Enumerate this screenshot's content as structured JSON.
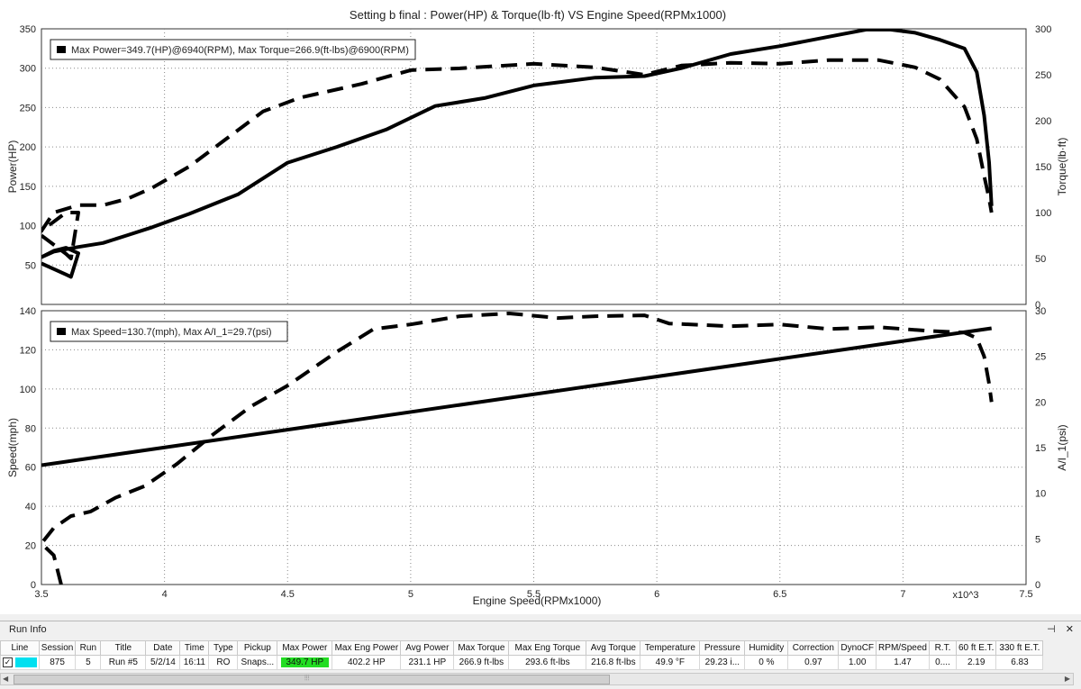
{
  "chart_data": [
    {
      "type": "line",
      "title": "Setting b final : Power(HP) & Torque(lb·ft) VS Engine Speed(RPMx1000)",
      "xlabel": "Engine Speed(RPMx1000)",
      "x_multiplier_label": "x10^3",
      "xlim": [
        3.5,
        7.5
      ],
      "x_ticks": [
        3.5,
        4,
        4.5,
        5,
        5.5,
        6,
        6.5,
        7,
        7.5
      ],
      "ylabel": "Power(HP)",
      "ylim": [
        0,
        350
      ],
      "y_ticks": [
        50,
        100,
        150,
        200,
        250,
        300,
        350
      ],
      "y2label": "Torque(lb·ft)",
      "y2lim": [
        0,
        300
      ],
      "y2_ticks": [
        0,
        50,
        100,
        150,
        200,
        250,
        300
      ],
      "grid": true,
      "legend_text": "Max Power=349.7(HP)@6940(RPM), Max Torque=266.9(ft-lbs)@6900(RPM)",
      "legend_position": "top-left",
      "series": [
        {
          "axis": "left",
          "style": "solid",
          "x": [
            3.5,
            3.55,
            3.6,
            3.62,
            3.65,
            3.6,
            3.55,
            3.5,
            3.55,
            3.65,
            3.75,
            3.85,
            3.95,
            4.1,
            4.3,
            4.5,
            4.7,
            4.9,
            5.1,
            5.3,
            5.5,
            5.75,
            5.95,
            6.1,
            6.3,
            6.5,
            6.7,
            6.85,
            6.95,
            7.05,
            7.15,
            7.25,
            7.3,
            7.33,
            7.35,
            7.36
          ],
          "values": [
            52,
            45,
            38,
            35,
            65,
            72,
            68,
            60,
            67,
            73,
            78,
            88,
            98,
            115,
            140,
            180,
            200,
            222,
            252,
            262,
            278,
            288,
            290,
            300,
            318,
            328,
            340,
            349,
            349,
            345,
            336,
            325,
            295,
            240,
            180,
            125
          ]
        },
        {
          "axis": "right",
          "style": "dashed",
          "x": [
            3.5,
            3.6,
            3.62,
            3.65,
            3.6,
            3.5,
            3.55,
            3.65,
            3.75,
            3.85,
            3.95,
            4.1,
            4.25,
            4.4,
            4.55,
            4.8,
            5.0,
            5.2,
            5.5,
            5.75,
            5.95,
            6.1,
            6.3,
            6.5,
            6.7,
            6.9,
            7.05,
            7.15,
            7.25,
            7.3,
            7.33,
            7.35,
            7.36
          ],
          "values": [
            75,
            55,
            50,
            100,
            100,
            80,
            100,
            108,
            108,
            115,
            127,
            150,
            180,
            210,
            225,
            240,
            255,
            257,
            262,
            258,
            250,
            260,
            263,
            262,
            266,
            266,
            258,
            245,
            215,
            180,
            140,
            115,
            100
          ]
        }
      ]
    },
    {
      "type": "line",
      "xlabel": "Engine Speed(RPMx1000)",
      "xlim": [
        3.5,
        7.5
      ],
      "x_ticks": [
        3.5,
        4,
        4.5,
        5,
        5.5,
        6,
        6.5,
        7,
        7.5
      ],
      "ylabel": "Speed(mph)",
      "ylim": [
        0,
        140
      ],
      "y_ticks": [
        0,
        20,
        40,
        60,
        80,
        100,
        120,
        140
      ],
      "y2label": "A/I_1(psi)",
      "y2lim": [
        0,
        30
      ],
      "y2_ticks": [
        0,
        5,
        10,
        15,
        20,
        25,
        30
      ],
      "grid": true,
      "legend_text": "Max Speed=130.7(mph), Max A/I_1=29.7(psi)",
      "legend_position": "top-left",
      "series": [
        {
          "axis": "left",
          "style": "solid",
          "x": [
            3.5,
            7.36
          ],
          "values": [
            61,
            131
          ]
        },
        {
          "axis": "right",
          "style": "dashed",
          "x": [
            3.58,
            3.55,
            3.5,
            3.55,
            3.62,
            3.7,
            3.8,
            3.92,
            4.05,
            4.2,
            4.35,
            4.5,
            4.7,
            4.85,
            5.0,
            5.2,
            5.4,
            5.6,
            5.75,
            5.95,
            6.05,
            6.3,
            6.5,
            6.7,
            6.9,
            7.1,
            7.25,
            7.3,
            7.33,
            7.35,
            7.36
          ],
          "values": [
            0,
            3.2,
            4.5,
            6.2,
            7.5,
            8.0,
            9.5,
            10.8,
            13.2,
            16.5,
            19.5,
            21.8,
            25.5,
            28.0,
            28.5,
            29.4,
            29.7,
            29.2,
            29.4,
            29.5,
            28.6,
            28.3,
            28.5,
            28.0,
            28.2,
            27.8,
            27.6,
            27.0,
            25.0,
            22.0,
            20.0
          ]
        }
      ]
    }
  ],
  "run_info": {
    "title": "Run Info",
    "controls": [
      "⊣",
      "✕"
    ],
    "columns": [
      "Line",
      "Session",
      "Run",
      "Title",
      "Date",
      "Time",
      "Type",
      "Pickup",
      "Max Power",
      "Max Eng Power",
      "Avg Power",
      "Max Torque",
      "Max Eng Torque",
      "Avg Torque",
      "Temperature",
      "Pressure",
      "Humidity",
      "Correction",
      "DynoCF",
      "RPM/Speed",
      "R.T.",
      "60 ft E.T.",
      "330 ft E.T."
    ],
    "row": [
      "",
      "875",
      "5",
      "Run #5",
      "5/2/14",
      "16:11",
      "RO",
      "Snaps...",
      "349.7 HP",
      "402.2 HP",
      "231.1 HP",
      "266.9 ft-lbs",
      "293.6 ft-lbs",
      "216.8 ft-lbs",
      "49.9 °F",
      "29.23 i...",
      "0 %",
      "0.97",
      "1.00",
      "1.47",
      "0....",
      "2.19",
      "6.83"
    ],
    "checkbox": "✓",
    "line_color": "#00e0f0",
    "max_power_highlight": "#22dd22",
    "scroll_grip": "⦙⦙⦙"
  }
}
